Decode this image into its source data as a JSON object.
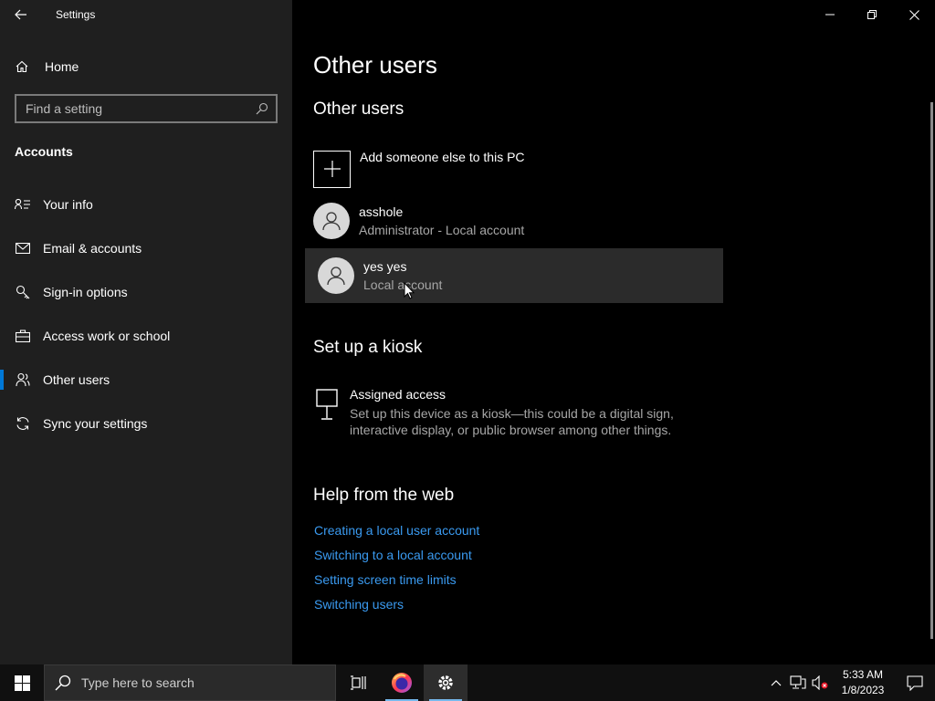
{
  "window": {
    "title": "Settings"
  },
  "sidebar": {
    "home_label": "Home",
    "search_placeholder": "Find a setting",
    "section_label": "Accounts",
    "items": [
      {
        "label": "Your info",
        "icon": "contact-icon"
      },
      {
        "label": "Email & accounts",
        "icon": "mail-icon"
      },
      {
        "label": "Sign-in options",
        "icon": "key-icon"
      },
      {
        "label": "Access work or school",
        "icon": "briefcase-icon"
      },
      {
        "label": "Other users",
        "icon": "people-icon",
        "active": true
      },
      {
        "label": "Sync your settings",
        "icon": "sync-icon"
      }
    ]
  },
  "main": {
    "page_title": "Other users",
    "other_users_heading": "Other users",
    "add_user_label": "Add someone else to this PC",
    "users": [
      {
        "name": "asshole",
        "type": "Administrator - Local account"
      },
      {
        "name": "yes yes",
        "type": "Local account"
      }
    ],
    "kiosk_heading": "Set up a kiosk",
    "kiosk_title": "Assigned access",
    "kiosk_desc": "Set up this device as a kiosk—this could be a digital sign, interactive display, or public browser among other things.",
    "help_heading": "Help from the web",
    "help_links": [
      "Creating a local user account",
      "Switching to a local account",
      "Setting screen time limits",
      "Switching users"
    ]
  },
  "taskbar": {
    "search_placeholder": "Type here to search",
    "time": "5:33 AM",
    "date": "1/8/2023"
  },
  "colors": {
    "accent": "#0078d7",
    "link": "#3a9af0",
    "sidebar_bg": "#1f1f1f"
  }
}
